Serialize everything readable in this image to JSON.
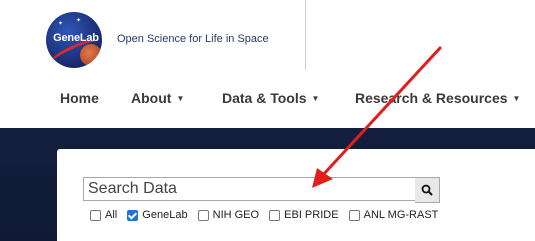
{
  "brand": {
    "logo_text": "GeneLab",
    "tagline": "Open Science for Life in Space"
  },
  "nav": {
    "items": [
      {
        "label": "Home",
        "has_caret": false
      },
      {
        "label": "About",
        "has_caret": true
      },
      {
        "label": "Data & Tools",
        "has_caret": true
      },
      {
        "label": "Research & Resources",
        "has_caret": true
      }
    ]
  },
  "search": {
    "placeholder": "Search Data",
    "button_icon": "search-icon"
  },
  "filters": [
    {
      "label": "All",
      "checked": false
    },
    {
      "label": "GeneLab",
      "checked": true
    },
    {
      "label": "NIH GEO",
      "checked": false
    },
    {
      "label": "EBI PRIDE",
      "checked": false
    },
    {
      "label": "ANL MG-RAST",
      "checked": false
    }
  ],
  "colors": {
    "band": "#141f3e",
    "checkbox_checked": "#1f73e0",
    "annotation_arrow": "#e01e1e"
  }
}
